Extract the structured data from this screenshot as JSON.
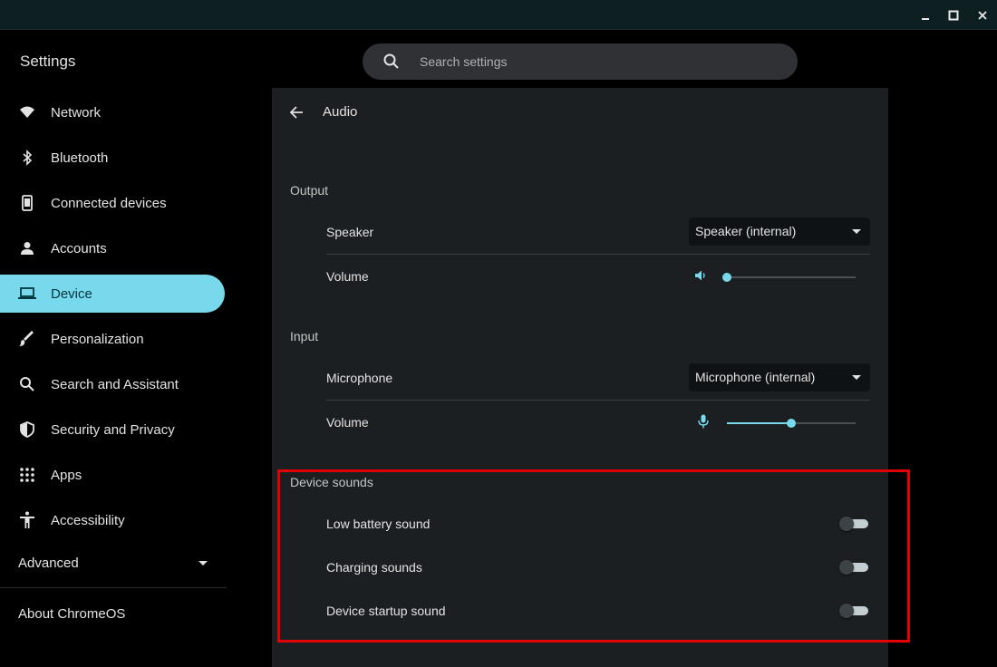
{
  "app": {
    "title": "Settings"
  },
  "search": {
    "placeholder": "Search settings"
  },
  "nav": {
    "items": [
      {
        "label": "Network",
        "icon": "wifi-icon"
      },
      {
        "label": "Bluetooth",
        "icon": "bluetooth-icon"
      },
      {
        "label": "Connected devices",
        "icon": "phone-icon"
      },
      {
        "label": "Accounts",
        "icon": "person-icon"
      },
      {
        "label": "Device",
        "icon": "laptop-icon",
        "active": true
      },
      {
        "label": "Personalization",
        "icon": "brush-icon"
      },
      {
        "label": "Search and Assistant",
        "icon": "search-icon"
      },
      {
        "label": "Security and Privacy",
        "icon": "shield-icon"
      },
      {
        "label": "Apps",
        "icon": "apps-grid-icon"
      },
      {
        "label": "Accessibility",
        "icon": "accessibility-icon"
      }
    ],
    "advanced": "Advanced",
    "about": "About ChromeOS"
  },
  "page": {
    "title": "Audio",
    "output": {
      "heading": "Output",
      "speaker_label": "Speaker",
      "speaker_value": "Speaker (internal)",
      "volume_label": "Volume",
      "volume_level": 0.0
    },
    "input": {
      "heading": "Input",
      "microphone_label": "Microphone",
      "microphone_value": "Microphone (internal)",
      "volume_label": "Volume",
      "volume_level": 0.5
    },
    "device_sounds": {
      "heading": "Device sounds",
      "items": [
        {
          "label": "Low battery sound",
          "on": false
        },
        {
          "label": "Charging sounds",
          "on": false
        },
        {
          "label": "Device startup sound",
          "on": false
        }
      ]
    }
  },
  "colors": {
    "accent": "#78d9ec",
    "highlight": "#e00000"
  }
}
